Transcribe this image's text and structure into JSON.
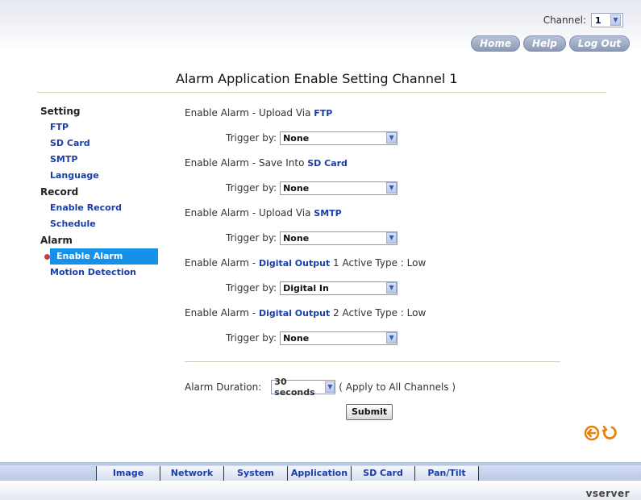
{
  "header": {
    "channel_label": "Channel:",
    "channel_value": "1",
    "nav": [
      "Home",
      "Help",
      "Log Out"
    ]
  },
  "page_title": "Alarm Application Enable Setting Channel 1",
  "sidebar": {
    "sections": [
      {
        "heading": "Setting",
        "items": [
          "FTP",
          "SD Card",
          "SMTP",
          "Language"
        ]
      },
      {
        "heading": "Record",
        "items": [
          "Enable Record",
          "Schedule"
        ]
      },
      {
        "heading": "Alarm",
        "items": [
          "Enable Alarm",
          "Motion Detection"
        ]
      }
    ],
    "active_item": "Enable Alarm"
  },
  "alarms": [
    {
      "prefix": "Enable Alarm - Upload Via ",
      "highlight": "FTP",
      "suffix": "",
      "trigger_label": "Trigger by:",
      "trigger_value": "None"
    },
    {
      "prefix": "Enable Alarm - Save Into ",
      "highlight": "SD Card",
      "suffix": "",
      "trigger_label": "Trigger by:",
      "trigger_value": "None"
    },
    {
      "prefix": "Enable Alarm - Upload Via ",
      "highlight": "SMTP",
      "suffix": "",
      "trigger_label": "Trigger by:",
      "trigger_value": "None"
    },
    {
      "prefix": "Enable Alarm - ",
      "highlight": "Digital Output",
      "suffix": " 1  Active Type : Low",
      "trigger_label": "Trigger by:",
      "trigger_value": "Digital In"
    },
    {
      "prefix": "Enable Alarm - ",
      "highlight": "Digital Output",
      "suffix": " 2  Active Type : Low",
      "trigger_label": "Trigger by:",
      "trigger_value": "None"
    }
  ],
  "duration": {
    "label": "Alarm Duration:",
    "value": "30 seconds",
    "note": "( Apply to All Channels )"
  },
  "submit_label": "Submit",
  "bottom_tabs": [
    "Image",
    "Network",
    "System",
    "Application",
    "SD Card",
    "Pan/Tilt"
  ],
  "brand": "vserver",
  "colors": {
    "accent": "#1591e9",
    "link": "#1a3ea8",
    "bullet": "#d13a3a"
  }
}
